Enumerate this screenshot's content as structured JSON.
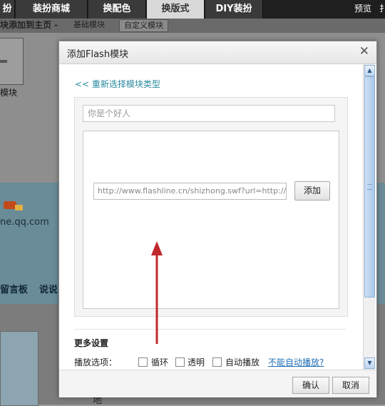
{
  "topbar": {
    "tabs": [
      {
        "label": "扮"
      },
      {
        "label": "装扮商城"
      },
      {
        "label": "换配色"
      },
      {
        "label": "换版式",
        "active": true
      },
      {
        "label": "DIY装扮"
      }
    ],
    "preview_label": "预览",
    "extra_label": "扌"
  },
  "subbar": {
    "title": "块添加到主页 -",
    "basic_modules": "基础模块",
    "custom_button": "自定义模块"
  },
  "background": {
    "module_label": "模块",
    "site_text": "ne.qq.com",
    "link_guestbook": "留言板",
    "link_talk": "说说",
    "bottom_text": "地"
  },
  "dialog": {
    "title": "添加Flash模块",
    "back_link": "<< 重新选择模块类型",
    "name_input_value": "你是个好人",
    "url_input_value": "http://www.flashline.cn/shizhong.swf?url=http://ji",
    "add_button": "添加",
    "more_settings_title": "更多设置",
    "play_options_label": "播放选项：",
    "options": [
      {
        "label": "循环",
        "checked": false
      },
      {
        "label": "透明",
        "checked": false
      },
      {
        "label": "自动播放",
        "checked": false
      }
    ],
    "cant_autoplay_link": "不能自动播放?",
    "confirm_button": "确认",
    "cancel_button": "取消"
  },
  "colors": {
    "annotation_arrow": "#c0282b",
    "link": "#2a8aa0"
  }
}
